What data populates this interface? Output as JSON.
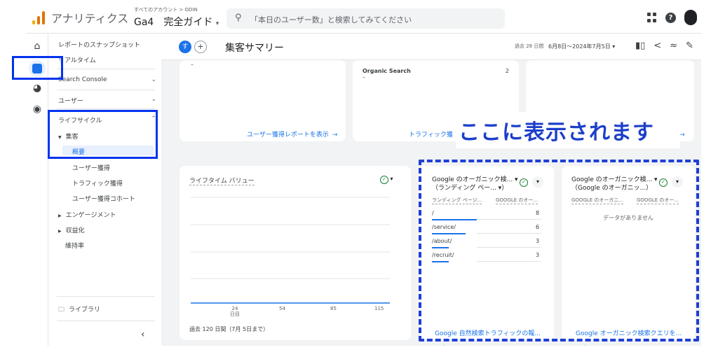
{
  "app": {
    "name": "アナリティクス",
    "account_path": "すべてのアカウント > ODIN",
    "property": "Ga4　完全ガイド",
    "logo_colors": [
      "#f9ab00",
      "#e37400",
      "#e37400"
    ]
  },
  "search": {
    "placeholder": "「本日のユーザー数」と検索してみてください"
  },
  "rail": {
    "icons": [
      "home-icon",
      "reports-icon",
      "explore-icon",
      "advertising-icon"
    ]
  },
  "sidebar": {
    "snapshot": "レポートのスナップショット",
    "realtime": "リアルタイム",
    "search_console": "Search Console",
    "users": "ユーザー",
    "lifecycle": "ライフサイクル",
    "acquisition": "集客",
    "overview": "概要",
    "user_acquisition": "ユーザー獲得",
    "traffic_acquisition": "トラフィック獲得",
    "user_acquisition_cohort": "ユーザー獲得コホート",
    "engagement": "エンゲージメント",
    "monetization": "収益化",
    "retention": "維持率",
    "library": "ライブラリ",
    "collapse": "‹"
  },
  "header": {
    "chip_label": "す",
    "title": "集客サマリー",
    "date_label": "過去 28 日間",
    "date_range": "6月8日～2024年7月5日"
  },
  "cards": {
    "top_left": {
      "dash": "–",
      "link": "ユーザー獲得レポートを表示"
    },
    "top_mid": {
      "row_label": "Organic Search",
      "row_value": "2",
      "dash": "–",
      "link": "トラフィック獲"
    },
    "top_right": {
      "link": "示"
    },
    "ltv": {
      "title": "ライフタイム バリュー",
      "x_ticks": [
        "24\n日目",
        "54",
        "85",
        "115"
      ],
      "footer": "過去 120 日間（7月 5日まで）"
    },
    "organic_landing": {
      "title_line1": "Google のオーガニック検... ▾",
      "title_line2": "（ランディング ペー... ▾）",
      "col1": "ランディング ページ...",
      "col2": "GOOGLE のオー...",
      "link": "Google 自然検索トラフィックの報..."
    },
    "organic_query": {
      "title_line1": "Google のオーガニック検... ▾",
      "title_line2": "（Google のオーガニッ...）",
      "col1": "GOOGLE のオーガニ...",
      "col2": "GOOGLE のオー...",
      "empty": "データがありません",
      "link": "Google オーガニック検索クエリを..."
    }
  },
  "landing_rows": [
    {
      "path": "/",
      "value": "8",
      "share": 1.0
    },
    {
      "path": "/service/",
      "value": "6",
      "share": 0.75
    },
    {
      "path": "/about/",
      "value": "3",
      "share": 0.375
    },
    {
      "path": "/recruit/",
      "value": "3",
      "share": 0.375
    }
  ],
  "annotation": {
    "callout": "ここに表示されます"
  },
  "colors": {
    "accent": "#1a73e8",
    "highlight": "#0033ee",
    "callout": "#1c3fc9"
  }
}
